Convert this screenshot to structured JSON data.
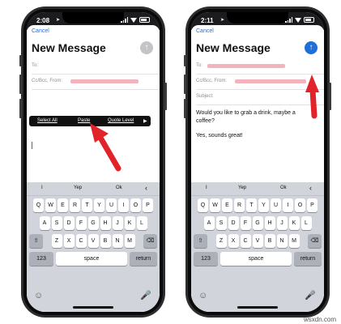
{
  "colors": {
    "accent": "#1e6fd9",
    "arrow": "#e2232a",
    "popup_bg": "#111111",
    "send_disabled": "#c4c4c6"
  },
  "left": {
    "status": {
      "time": "2:08",
      "location_icon": "location-arrow-icon"
    },
    "cancel": "Cancel",
    "title": "New Message",
    "send_state": "disabled",
    "send_icon": "arrow-up-icon",
    "to_label": "To:",
    "ccbcc_label": "Cc/Bcc, From:",
    "popup": {
      "items": [
        "Select All",
        "Paste",
        "Quote Level"
      ],
      "more": "▶"
    },
    "suggestions": [
      "I",
      "Yep",
      "Ok"
    ],
    "suggest_collapse": "‹",
    "keyboard": {
      "row1": [
        "Q",
        "W",
        "E",
        "R",
        "T",
        "Y",
        "U",
        "I",
        "O",
        "P"
      ],
      "row2": [
        "A",
        "S",
        "D",
        "F",
        "G",
        "H",
        "J",
        "K",
        "L"
      ],
      "row3": [
        "Z",
        "X",
        "C",
        "V",
        "B",
        "N",
        "M"
      ],
      "shift": "⇧",
      "delete": "⌫",
      "numbers": "123",
      "space": "space",
      "return": "return",
      "emoji": "☺",
      "mic": "🎤"
    }
  },
  "right": {
    "status": {
      "time": "2:11",
      "location_icon": "location-arrow-icon"
    },
    "cancel": "Cancel",
    "title": "New Message",
    "send_state": "enabled",
    "send_icon": "arrow-up-icon",
    "to_label": "To:",
    "ccbcc_label": "Cc/Bcc, From:",
    "subject_label": "Subject:",
    "body_line1": "Would you like to grab a drink, maybe a coffee?",
    "body_line2": "Yes, sounds great!",
    "suggestions": [
      "I",
      "Yep",
      "Ok"
    ],
    "suggest_collapse": "‹",
    "keyboard": {
      "row1": [
        "Q",
        "W",
        "E",
        "R",
        "T",
        "Y",
        "U",
        "I",
        "O",
        "P"
      ],
      "row2": [
        "A",
        "S",
        "D",
        "F",
        "G",
        "H",
        "J",
        "K",
        "L"
      ],
      "row3": [
        "Z",
        "X",
        "C",
        "V",
        "B",
        "N",
        "M"
      ],
      "shift": "⇧",
      "delete": "⌫",
      "numbers": "123",
      "space": "space",
      "return": "return",
      "emoji": "☺",
      "mic": "🎤"
    }
  },
  "watermark": "wsxdn.com"
}
